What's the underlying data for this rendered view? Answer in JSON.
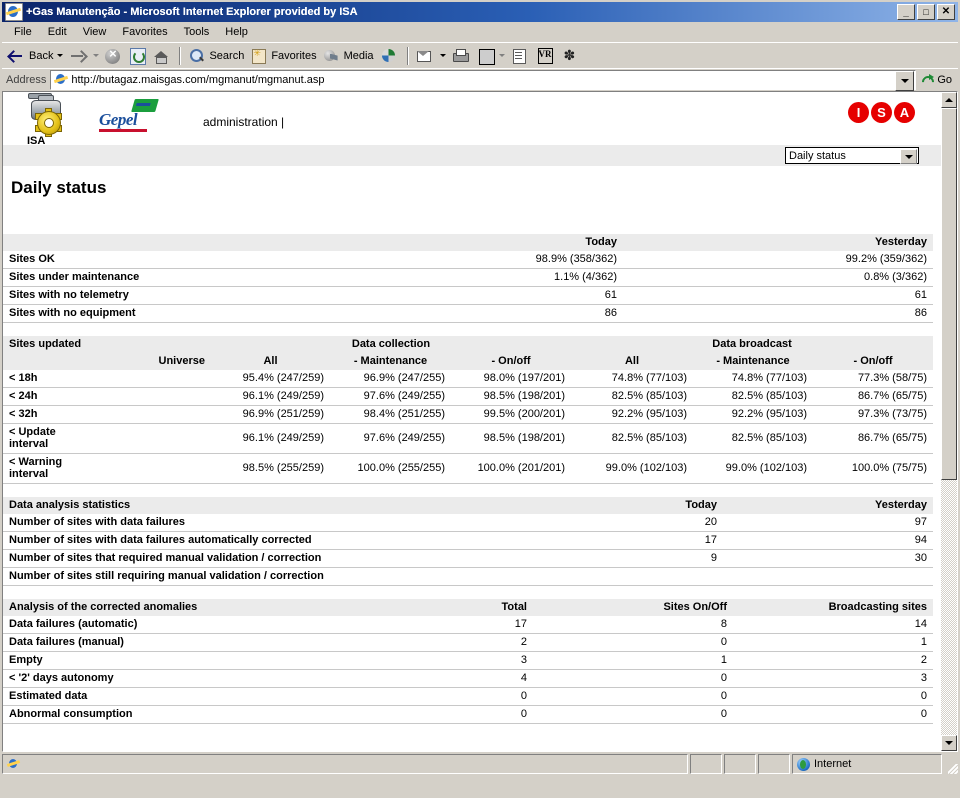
{
  "window": {
    "title": "+Gas Manutenção - Microsoft Internet Explorer provided by ISA",
    "minimize_label": "_",
    "maximize_label": "□",
    "close_label": "✕"
  },
  "menu": {
    "items": [
      "File",
      "Edit",
      "View",
      "Favorites",
      "Tools",
      "Help"
    ]
  },
  "toolbar": {
    "back": "Back",
    "forward": "",
    "stop": "",
    "refresh": "",
    "home": "",
    "search": "Search",
    "favorites": "Favorites",
    "media": "Media",
    "history": "",
    "mail": "",
    "print": "",
    "edit": "",
    "discuss": "",
    "research": "",
    "messenger": ""
  },
  "address": {
    "label": "Address",
    "url": "http://butagaz.maisgas.com/mgmanut/mgmanut.asp",
    "go_label": "Go"
  },
  "header": {
    "isa_caption": "ISA",
    "gepel_label": "Gepel",
    "admin_link": "administration  |",
    "isa_letters": [
      "I",
      "S",
      "A"
    ],
    "isa_color": "#e60000"
  },
  "view_selector": {
    "selected": "Daily status",
    "options": [
      "Daily status"
    ]
  },
  "page_title": "Daily status",
  "tables": [
    {
      "name": "site-status",
      "headers": [
        "",
        "Today",
        "Yesterday"
      ],
      "rows": [
        {
          "label": "Sites OK",
          "values": [
            "98.9% (358/362)",
            "99.2% (359/362)"
          ]
        },
        {
          "label": "Sites under maintenance",
          "values": [
            "1.1% (4/362)",
            "0.8% (3/362)"
          ]
        },
        {
          "label": "Sites with no telemetry",
          "values": [
            "61",
            "61"
          ]
        },
        {
          "label": "Sites with no equipment",
          "values": [
            "86",
            "86"
          ]
        }
      ]
    },
    {
      "name": "sites-updated",
      "group_headers": [
        {
          "label": "Sites updated",
          "span": 2
        },
        {
          "label": "Data collection",
          "span": 3
        },
        {
          "label": "Data broadcast",
          "span": 3
        }
      ],
      "headers": [
        "",
        "Universe",
        "All",
        "- Maintenance",
        "- On/off",
        "All",
        "- Maintenance",
        "- On/off"
      ],
      "rows": [
        {
          "label": "< 18h",
          "values": [
            "",
            "95.4% (247/259)",
            "96.9% (247/255)",
            "98.0% (197/201)",
            "74.8% (77/103)",
            "74.8% (77/103)",
            "77.3% (58/75)"
          ]
        },
        {
          "label": "< 24h",
          "values": [
            "",
            "96.1% (249/259)",
            "97.6% (249/255)",
            "98.5% (198/201)",
            "82.5% (85/103)",
            "82.5% (85/103)",
            "86.7% (65/75)"
          ]
        },
        {
          "label": "< 32h",
          "values": [
            "",
            "96.9% (251/259)",
            "98.4% (251/255)",
            "99.5% (200/201)",
            "92.2% (95/103)",
            "92.2% (95/103)",
            "97.3% (73/75)"
          ]
        },
        {
          "label": "< Update interval",
          "values": [
            "",
            "96.1% (249/259)",
            "97.6% (249/255)",
            "98.5% (198/201)",
            "82.5% (85/103)",
            "82.5% (85/103)",
            "86.7% (65/75)"
          ]
        },
        {
          "label": "< Warning interval",
          "values": [
            "",
            "98.5% (255/259)",
            "100.0% (255/255)",
            "100.0% (201/201)",
            "99.0% (102/103)",
            "99.0% (102/103)",
            "100.0% (75/75)"
          ]
        }
      ]
    },
    {
      "name": "data-analysis-statistics",
      "headers": [
        "Data analysis statistics",
        "Today",
        "Yesterday"
      ],
      "rows": [
        {
          "label": "Number of sites with data failures",
          "values": [
            "20",
            "97"
          ]
        },
        {
          "label": "Number of sites with data failures automatically corrected",
          "values": [
            "17",
            "94"
          ]
        },
        {
          "label": "Number of sites that required manual validation / correction",
          "values": [
            "9",
            "30"
          ]
        },
        {
          "label": "Number of sites still requiring manual validation / correction",
          "values": [
            "",
            ""
          ]
        }
      ]
    },
    {
      "name": "corrected-anomalies",
      "headers": [
        "Analysis of the corrected anomalies",
        "Total",
        "Sites On/Off",
        "Broadcasting sites"
      ],
      "rows": [
        {
          "label": "Data failures (automatic)",
          "values": [
            "17",
            "8",
            "14"
          ]
        },
        {
          "label": "Data failures (manual)",
          "values": [
            "2",
            "0",
            "1"
          ]
        },
        {
          "label": "Empty",
          "values": [
            "3",
            "1",
            "2"
          ]
        },
        {
          "label": "< '2' days autonomy",
          "values": [
            "4",
            "0",
            "3"
          ]
        },
        {
          "label": "Estimated data",
          "values": [
            "0",
            "0",
            "0"
          ]
        },
        {
          "label": "Abnormal consumption",
          "values": [
            "0",
            "0",
            "0"
          ]
        }
      ]
    }
  ],
  "statusbar": {
    "message": "",
    "zone": "Internet"
  }
}
